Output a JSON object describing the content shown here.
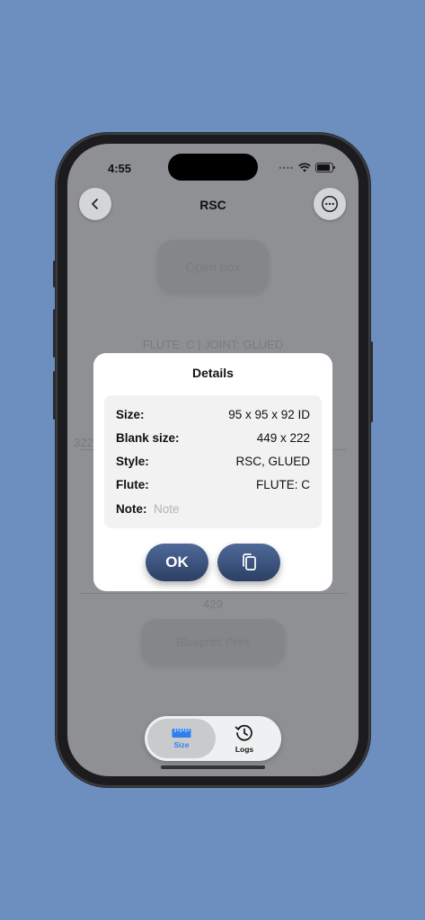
{
  "status": {
    "time": "4:55"
  },
  "nav": {
    "title": "RSC",
    "back_icon": "chevron-left-icon",
    "more_icon": "ellipsis-circle-icon"
  },
  "background": {
    "top_button": "Open box",
    "flute_joint": "FLUTE: C | JOINT: GLUED",
    "dim_left": "322",
    "dim_bottom": "429",
    "bottom_button": "Blueprint Print"
  },
  "dialog": {
    "title": "Details",
    "rows": [
      {
        "label": "Size:",
        "value": "95 x 95 x 92 ID"
      },
      {
        "label": "Blank size:",
        "value": "449 x 222"
      },
      {
        "label": "Style:",
        "value": "RSC, GLUED"
      },
      {
        "label": "Flute:",
        "value": "FLUTE: C"
      }
    ],
    "note_label": "Note:",
    "note_placeholder": "Note",
    "ok_label": "OK",
    "copy_icon": "copy-icon"
  },
  "tabs": [
    {
      "label": "Size",
      "icon": "ruler-icon",
      "active": true
    },
    {
      "label": "Logs",
      "icon": "clock-history-icon",
      "active": false
    }
  ],
  "colors": {
    "accent": "#2f80ed",
    "button": "#34486f",
    "background": "#6d8fc0"
  }
}
